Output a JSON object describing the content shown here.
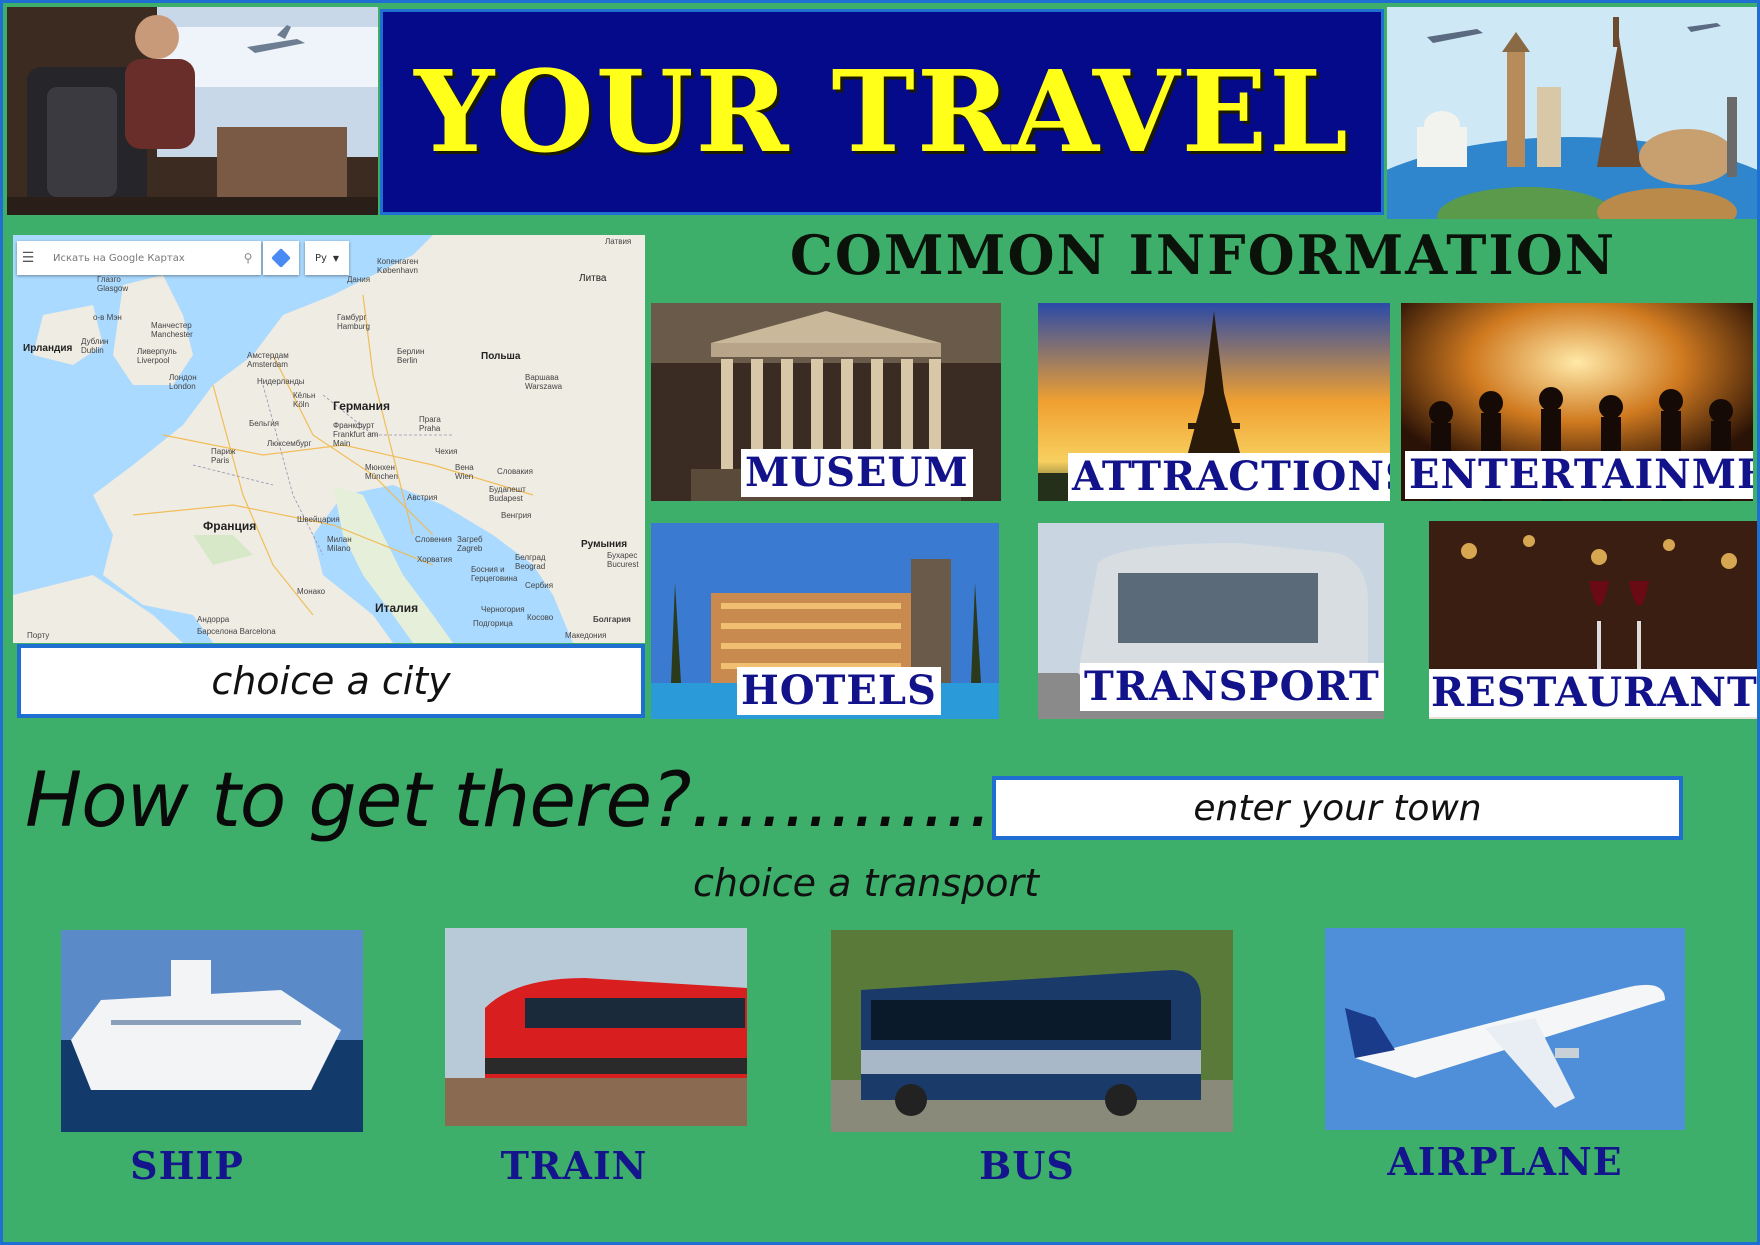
{
  "header": {
    "title": "YOUR TRAVEL",
    "left_image": "traveler-train-window",
    "right_image": "world-landmarks-globe"
  },
  "map": {
    "search_placeholder": "Искать на Google Картах",
    "lang_label": "Ру",
    "labels": {
      "latvia": "Латвия",
      "copenhagen": "Копенгаген København",
      "denmark": "Дания",
      "lithuania": "Литва",
      "glasgow": "Глазго Glasgow",
      "isle_of_man": "о-в Мэн",
      "manchester": "Манчестер Manchester",
      "dublin": "Дублин Dublin",
      "ireland": "Ирландия",
      "liverpool": "Ливерпуль Liverpool",
      "hamburg": "Гамбург Hamburg",
      "berlin": "Берлин Berlin",
      "poland": "Польша",
      "amsterdam": "Амстердам Amsterdam",
      "netherlands": "Нидерланды",
      "london": "Лондон London",
      "warsaw": "Варшава Warszawa",
      "koln": "Кёльн Köln",
      "germany": "Германия",
      "belgium": "Бельгия",
      "frankfurt": "Франкфурт Frankfurt am Main",
      "prague": "Прага Praha",
      "paris": "Париж Paris",
      "luxembourg": "Люксембург",
      "czechia": "Чехия",
      "munich": "Мюнхен München",
      "vienna": "Вена Wien",
      "slovakia": "Словакия",
      "budapest": "Будапешт Budapest",
      "austria": "Австрия",
      "france": "Франция",
      "switzerland": "Швейцария",
      "hungary": "Венгрия",
      "milan": "Милан Milano",
      "slovenia": "Словения",
      "zagreb": "Загреб Zagreb",
      "romania": "Румыния",
      "croatia": "Хорватия",
      "bucharest": "Бухарес Bucurest",
      "bosnia": "Босния и Герцеговина",
      "belgrade": "Белград Beograd",
      "monaco": "Монако",
      "serbia": "Сербия",
      "italy": "Италия",
      "andorra": "Андорра",
      "montenegro": "Черногория",
      "kosovo": "Косово",
      "bulgaria": "Болгария",
      "barcelona": "Барселона Barcelona",
      "podgorica": "Подгорица",
      "porto": "Порту",
      "macedonia": "Македония"
    }
  },
  "city_input": {
    "value": "choice a city"
  },
  "common": {
    "title": "COMMON INFORMATION",
    "tiles": [
      {
        "label": "MUSEUM",
        "image": "museum-columns"
      },
      {
        "label": "ATTRACTIONS",
        "image": "eiffel-tower-sunset"
      },
      {
        "label": "ENTERTAINMENT",
        "image": "party-crowd"
      },
      {
        "label": "HOTELS",
        "image": "hotel-pool"
      },
      {
        "label": "TRANSPORT",
        "image": "city-bus"
      },
      {
        "label": "RESTAURANTS",
        "image": "wine-glasses-table"
      }
    ]
  },
  "how": {
    "question": "How to get there?..............",
    "town_input_value": "enter your town",
    "choose_transport": "choice a transport"
  },
  "transport": [
    {
      "label": "SHIP",
      "image": "cruise-ship"
    },
    {
      "label": "TRAIN",
      "image": "red-train"
    },
    {
      "label": "BUS",
      "image": "greyhound-bus"
    },
    {
      "label": "AIRPLANE",
      "image": "airbus-a380"
    }
  ],
  "colors": {
    "background": "#3daf6a",
    "title_bg": "#050a8a",
    "title_text": "#ffff1a",
    "label_text": "#14148c",
    "border": "#1e6fd1"
  }
}
